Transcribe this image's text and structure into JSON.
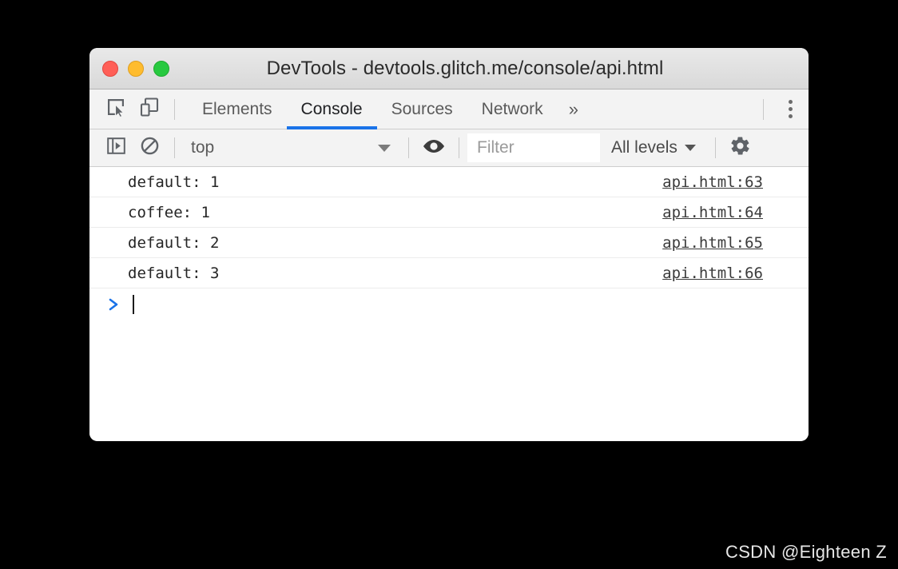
{
  "window": {
    "title": "DevTools - devtools.glitch.me/console/api.html",
    "traffic_lights": [
      {
        "name": "close",
        "color": "#ff5f57"
      },
      {
        "name": "minimize",
        "color": "#febc2e"
      },
      {
        "name": "zoom",
        "color": "#27c93f"
      }
    ]
  },
  "tabbar": {
    "inspect_icon": "inspect-element-icon",
    "device_toolbar_icon": "device-toolbar-icon",
    "tabs": [
      {
        "label": "Elements",
        "active": false
      },
      {
        "label": "Console",
        "active": true
      },
      {
        "label": "Sources",
        "active": false
      },
      {
        "label": "Network",
        "active": false
      }
    ],
    "more_tabs_label": "»",
    "menu_icon": "kebab-menu-icon",
    "active_underline_color": "#1a73e8"
  },
  "console_toolbar": {
    "sidebar_toggle_icon": "console-sidebar-toggle-icon",
    "clear_icon": "clear-console-icon",
    "context": {
      "value": "top",
      "caret_icon": "chevron-down-icon"
    },
    "live_expression_icon": "eye-icon",
    "filter": {
      "value": "",
      "placeholder": "Filter"
    },
    "log_levels": {
      "value": "All levels",
      "caret_icon": "chevron-down-icon"
    },
    "settings_icon": "gear-icon"
  },
  "console": {
    "rows": [
      {
        "message": "default: 1",
        "source": "api.html:63"
      },
      {
        "message": "coffee: 1",
        "source": "api.html:64"
      },
      {
        "message": "default: 2",
        "source": "api.html:65"
      },
      {
        "message": "default: 3",
        "source": "api.html:66"
      }
    ],
    "prompt": {
      "chevron_icon": "prompt-chevron-icon",
      "input_value": ""
    }
  },
  "watermark": {
    "text": "CSDN @Eighteen Z"
  }
}
